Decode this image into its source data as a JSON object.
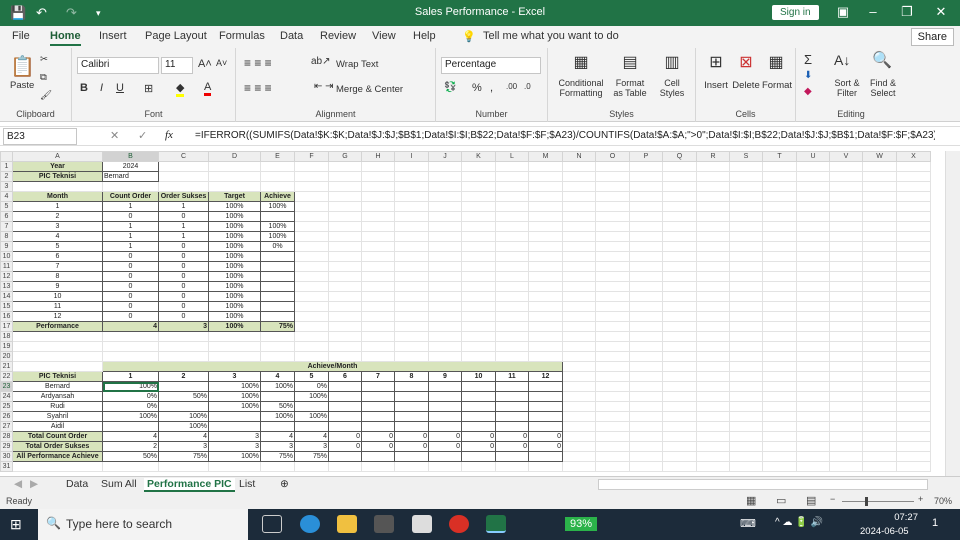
{
  "window": {
    "title": "Sales Performance  -  Excel",
    "sign_in": "Sign in"
  },
  "menu_tabs": [
    "File",
    "Home",
    "Insert",
    "Page Layout",
    "Formulas",
    "Data",
    "Review",
    "View",
    "Help"
  ],
  "tell_me": "Tell me what you want to do",
  "share": "Share",
  "ribbon": {
    "clipboard": {
      "label": "Clipboard",
      "paste": "Paste"
    },
    "font": {
      "label": "Font",
      "name": "Calibri",
      "size": "11"
    },
    "alignment": {
      "label": "Alignment",
      "wrap": "Wrap Text",
      "merge": "Merge & Center"
    },
    "number": {
      "label": "Number",
      "format": "Percentage"
    },
    "styles": {
      "label": "Styles",
      "cond": "Conditional Formatting",
      "table": "Format as Table",
      "cell": "Cell Styles"
    },
    "cells": {
      "label": "Cells",
      "insert": "Insert",
      "delete": "Delete",
      "format": "Format"
    },
    "editing": {
      "label": "Editing",
      "sort": "Sort & Filter",
      "find": "Find & Select"
    }
  },
  "formula_bar": {
    "name_box": "B23",
    "formula": "=IFERROR((SUMIFS(Data!$K:$K;Data!$J:$J;$B$1;Data!$I:$I;B$22;Data!$F:$F;$A23)/COUNTIFS(Data!$A:$A;\">0\";Data!$I:$I;B$22;Data!$J:$J;$B$1;Data!$F:$F;$A23));"
  },
  "columns": [
    "A",
    "B",
    "C",
    "D",
    "E",
    "F",
    "G",
    "H",
    "I",
    "J",
    "K",
    "L",
    "M",
    "N",
    "O",
    "P",
    "Q",
    "R",
    "S",
    "T",
    "U",
    "V",
    "W",
    "X"
  ],
  "sheet": {
    "rows": {
      "1": [
        "Year",
        "2024"
      ],
      "2": [
        "PIC Teknisi",
        "Bernard"
      ],
      "3": [],
      "4": [
        "Month",
        "Count Order",
        "Order Sukses",
        "Target",
        "Achieve"
      ],
      "5": [
        "1",
        "1",
        "1",
        "100%",
        "100%"
      ],
      "6": [
        "2",
        "0",
        "0",
        "100%",
        ""
      ],
      "7": [
        "3",
        "1",
        "1",
        "100%",
        "100%"
      ],
      "8": [
        "4",
        "1",
        "1",
        "100%",
        "100%"
      ],
      "9": [
        "5",
        "1",
        "0",
        "100%",
        "0%"
      ],
      "10": [
        "6",
        "0",
        "0",
        "100%",
        ""
      ],
      "11": [
        "7",
        "0",
        "0",
        "100%",
        ""
      ],
      "12": [
        "8",
        "0",
        "0",
        "100%",
        ""
      ],
      "13": [
        "9",
        "0",
        "0",
        "100%",
        ""
      ],
      "14": [
        "10",
        "0",
        "0",
        "100%",
        ""
      ],
      "15": [
        "11",
        "0",
        "0",
        "100%",
        ""
      ],
      "16": [
        "12",
        "0",
        "0",
        "100%",
        ""
      ],
      "17": [
        "Performance",
        "4",
        "3",
        "100%",
        "75%"
      ],
      "18": [],
      "19": [],
      "20": [],
      "21": [
        "",
        "Achieve/Month"
      ],
      "22": [
        "PIC Teknisi",
        "1",
        "2",
        "3",
        "4",
        "5",
        "6",
        "7",
        "8",
        "9",
        "10",
        "11",
        "12"
      ],
      "23": [
        "Bernard",
        "100%",
        "",
        "100%",
        "100%",
        "0%",
        "",
        "",
        "",
        "",
        "",
        "",
        ""
      ],
      "24": [
        "Ardyansah",
        "0%",
        "50%",
        "100%",
        "",
        "100%",
        "",
        "",
        "",
        "",
        "",
        "",
        ""
      ],
      "25": [
        "Rudi",
        "0%",
        "",
        "100%",
        "50%",
        "",
        "",
        "",
        "",
        "",
        "",
        "",
        ""
      ],
      "26": [
        "Syahril",
        "100%",
        "100%",
        "",
        "100%",
        "100%",
        "",
        "",
        "",
        "",
        "",
        "",
        ""
      ],
      "27": [
        "Aidil",
        "",
        "100%",
        "",
        "",
        "",
        "",
        "",
        "",
        "",
        "",
        "",
        ""
      ],
      "28": [
        "Total Count Order",
        "4",
        "4",
        "3",
        "4",
        "4",
        "0",
        "0",
        "0",
        "0",
        "0",
        "0",
        "0"
      ],
      "29": [
        "Total Order Sukses",
        "2",
        "3",
        "3",
        "3",
        "3",
        "0",
        "0",
        "0",
        "0",
        "0",
        "0",
        "0"
      ],
      "30": [
        "All Performance Achieve",
        "50%",
        "75%",
        "100%",
        "75%",
        "75%",
        "",
        "",
        "",
        "",
        "",
        "",
        ""
      ],
      "31": []
    }
  },
  "sheet_tabs": [
    "Data",
    "Sum All",
    "Performance PIC",
    "List"
  ],
  "active_sheet": "Performance PIC",
  "status": {
    "ready": "Ready",
    "zoom": "70%"
  },
  "taskbar": {
    "search": "Type here to search",
    "battery": "93%",
    "time": "07:27",
    "date": "2024-06-05",
    "notifications": "1"
  },
  "colors": {
    "accent": "#217346",
    "header_fill": "#d8e4bc"
  }
}
